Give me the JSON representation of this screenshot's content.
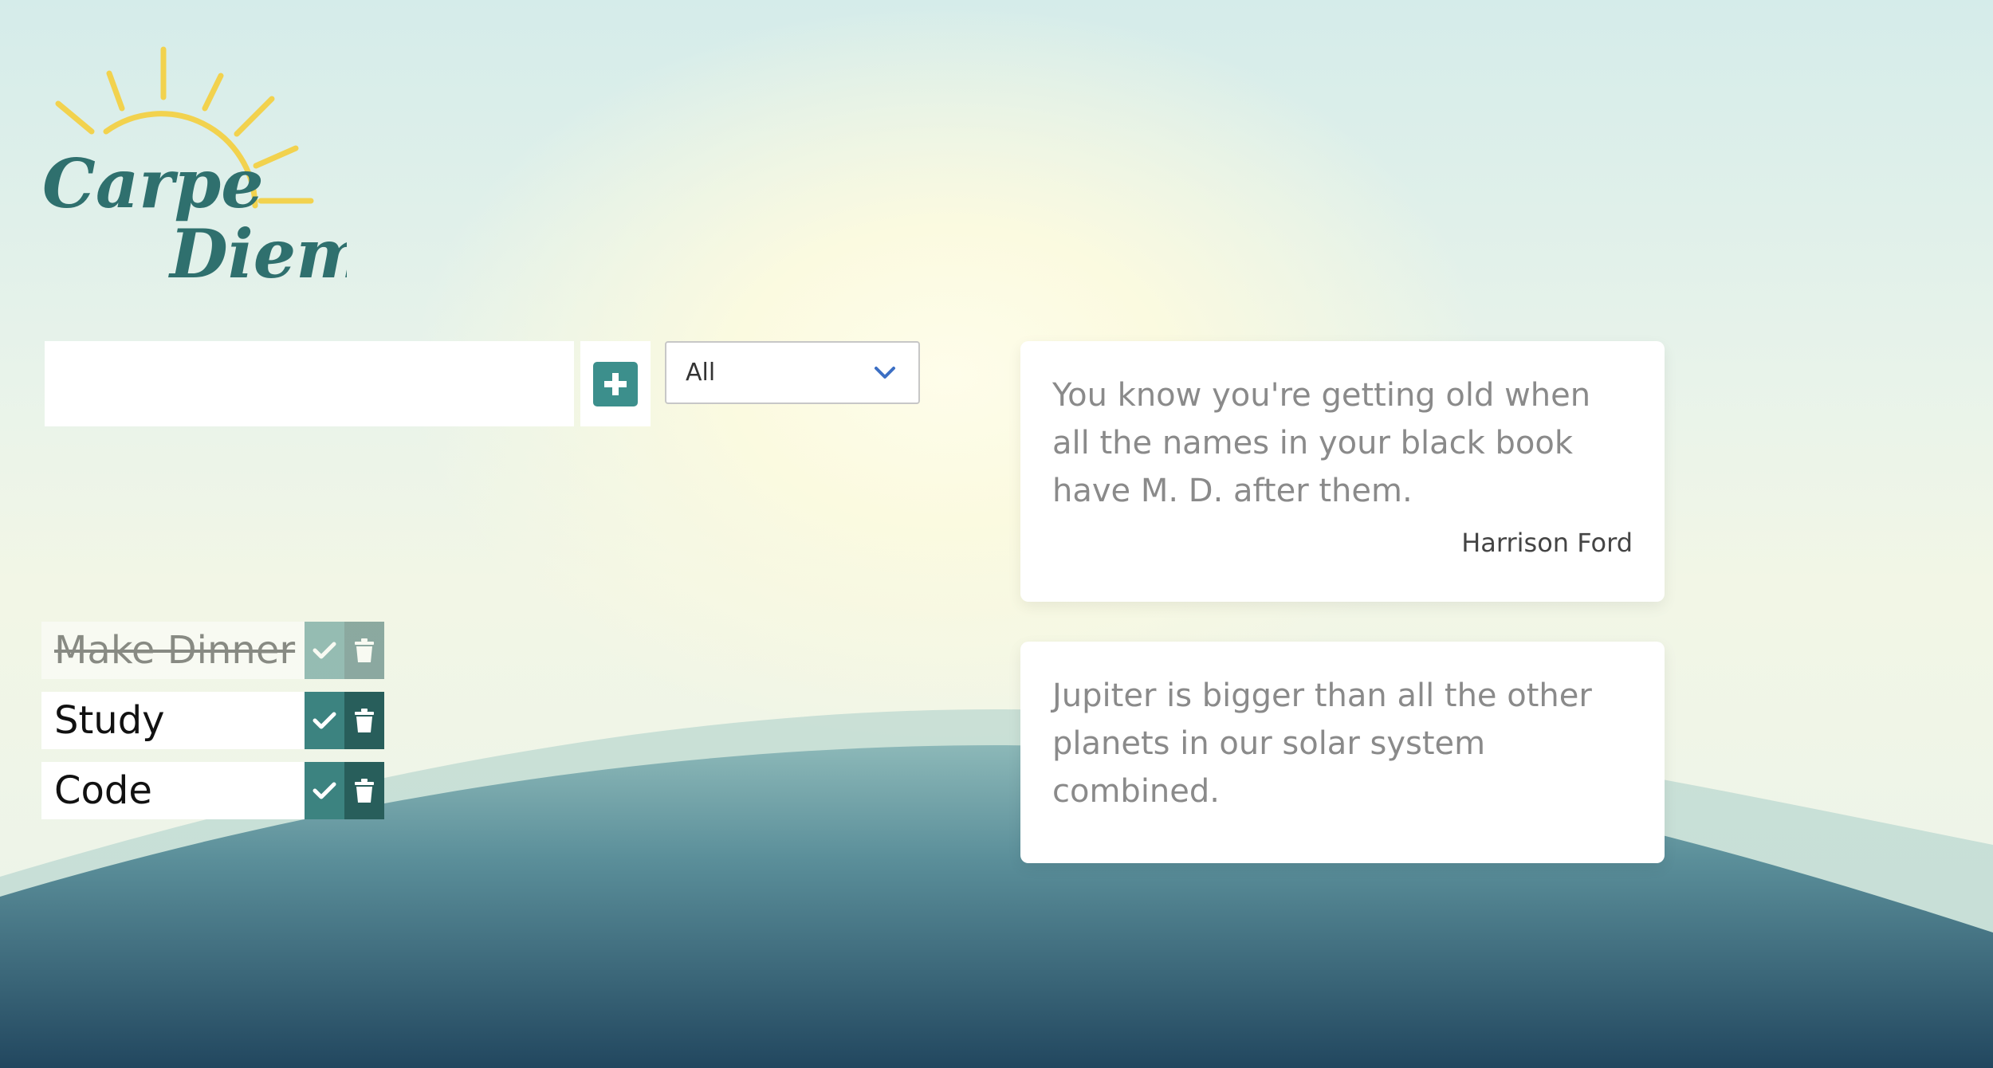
{
  "logo": {
    "line1": "Carpe",
    "line2": "Diem"
  },
  "add_form": {
    "input_value": "",
    "input_placeholder": ""
  },
  "filter": {
    "selected": "All"
  },
  "todos": [
    {
      "text": "Make Dinner",
      "completed": true
    },
    {
      "text": "Study",
      "completed": false
    },
    {
      "text": "Code",
      "completed": false
    }
  ],
  "quote": {
    "text": "You know you're getting old when all the names in your black book have M. D. after them.",
    "author": "Harrison Ford"
  },
  "fact": {
    "text": "Jupiter is bigger than all the other planets in our solar system combined."
  },
  "colors": {
    "accent": "#3c8f8c",
    "complete_button": "#3c8380",
    "trash_button": "#285e5b",
    "sun": "#f2d24e",
    "wave_dark": "#244e66"
  },
  "icons": {
    "add": "plus-icon",
    "dropdown": "chevron-down-icon",
    "complete": "check-icon",
    "delete": "trash-icon"
  }
}
